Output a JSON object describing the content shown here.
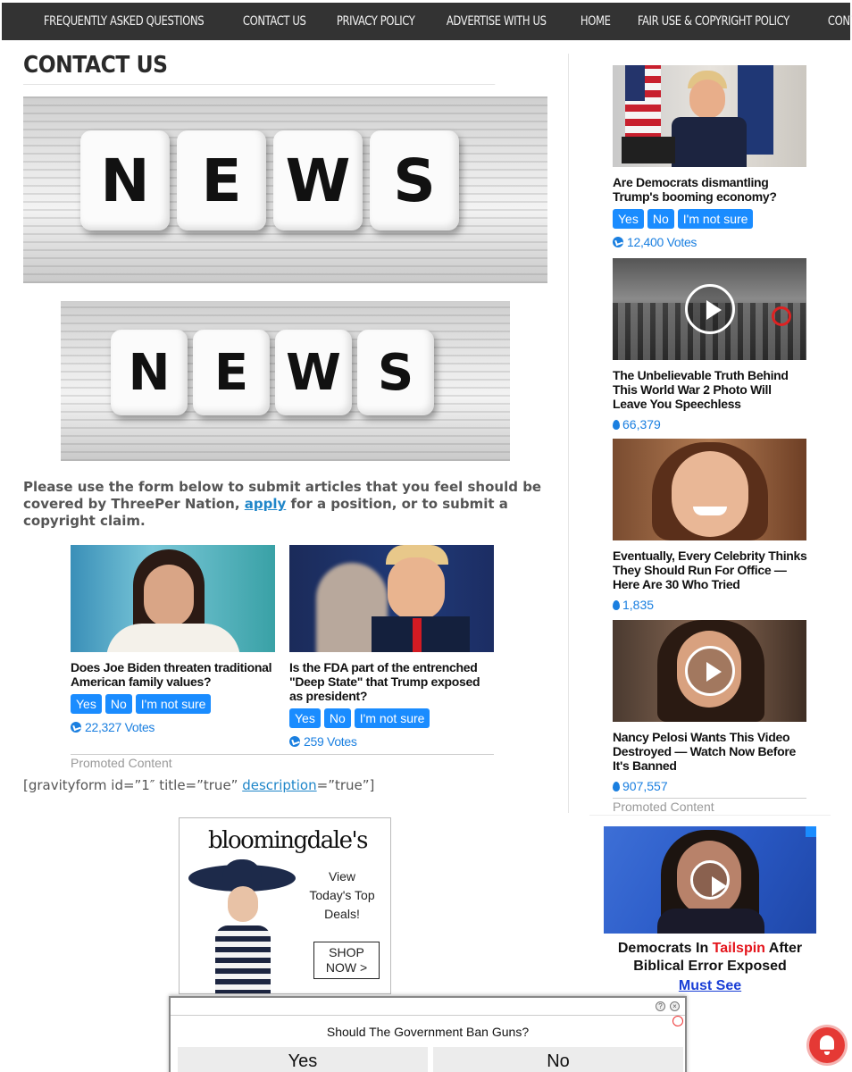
{
  "nav": {
    "items": [
      "FREQUENTLY ASKED QUESTIONS",
      "CONTACT US",
      "PRIVACY POLICY",
      "ADVERTISE WITH US",
      "HOME",
      "FAIR USE & COPYRIGHT POLICY",
      "CONTACT US"
    ]
  },
  "page": {
    "title": "CONTACT US",
    "news_letters": [
      "N",
      "E",
      "W",
      "S"
    ],
    "intro_before": "Please use the form below to submit articles that you feel should be covered by ThreePer Nation, ",
    "intro_link": "apply",
    "intro_after": " for a position, or to submit a copyright claim.",
    "gform_before": "[gravityform id=”1″ title=”true” ",
    "gform_link": "description",
    "gform_after": "=”true”]"
  },
  "promoted": {
    "label": "Promoted Content",
    "cards": [
      {
        "question": "Does Joe Biden threaten traditional American family values?",
        "yes": "Yes",
        "no": "No",
        "unsure": "I'm not sure",
        "votes": "22,327 Votes"
      },
      {
        "question": "Is the FDA part of the entrenched \"Deep State\" that Trump exposed as president?",
        "yes": "Yes",
        "no": "No",
        "unsure": "I'm not sure",
        "votes": "259 Votes"
      }
    ]
  },
  "ad_bloom": {
    "logo": "bloomingdale's",
    "text": "View Today's Top Deals!",
    "shop": "SHOP NOW >"
  },
  "sidebar": {
    "poll_card": {
      "title": "Are Democrats dismantling Trump's booming economy?",
      "yes": "Yes",
      "no": "No",
      "unsure": "I'm not sure",
      "votes": "12,400 Votes"
    },
    "cards": [
      {
        "title": "The Unbelievable Truth Behind This World War 2 Photo Will Leave You Speechless",
        "count": "66,379"
      },
      {
        "title": "Eventually, Every Celebrity Thinks They Should Run For Office — Here Are 30 Who Tried",
        "count": "1,835"
      },
      {
        "title": "Nancy Pelosi Wants This Video Destroyed — Watch Now Before It's Banned",
        "count": "907,557"
      }
    ],
    "promoted_label": "Promoted Content",
    "ad": {
      "pre": "Democrats In ",
      "red": "Tailspin",
      "post": " After Biblical Error Exposed",
      "cta": "Must See"
    }
  },
  "poll_popup": {
    "question": "Should The Government Ban Guns?",
    "yes": "Yes",
    "no": "No"
  },
  "colors": {
    "nav_bg": "#333333",
    "accent": "#1a8cff",
    "link": "#1f86c9",
    "alert": "#e53935"
  }
}
